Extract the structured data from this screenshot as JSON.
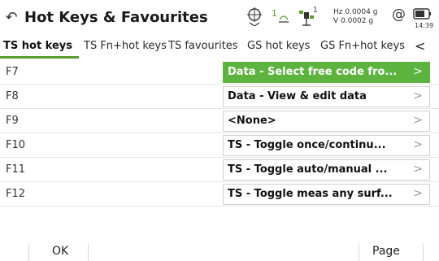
{
  "window": {
    "title": "Hot Keys & Favourites"
  },
  "status_bar": {
    "bluetooth_icon": "target-crosshair-icon",
    "signal_text": "1",
    "satellite_text": "1",
    "hz_label": "Hz 0.0004 g",
    "v_label": "V  0.0002 g",
    "prism_icon": "at-prism-icon",
    "battery_icon": "battery-icon",
    "time": "14:39"
  },
  "tabs": [
    {
      "label": "TS hot keys",
      "active": true
    },
    {
      "label": "TS Fn+hot keys",
      "active": false
    },
    {
      "label": "TS favourites",
      "active": false
    },
    {
      "label": "GS hot keys",
      "active": false
    },
    {
      "label": "GS Fn+hot keys",
      "active": false
    }
  ],
  "tab_nav": {
    "prev": "<",
    "next": ">"
  },
  "rows": [
    {
      "key": "F7",
      "value": "Data - Select free code fro...",
      "selected": true
    },
    {
      "key": "F8",
      "value": "Data - View & edit data",
      "selected": false
    },
    {
      "key": "F9",
      "value": "<None>",
      "selected": false
    },
    {
      "key": "F10",
      "value": "TS - Toggle once/continu...",
      "selected": false
    },
    {
      "key": "F11",
      "value": "TS - Toggle auto/manual ...",
      "selected": false
    },
    {
      "key": "F12",
      "value": "TS - Toggle meas any surf...",
      "selected": false
    }
  ],
  "chevron": ">",
  "softkeys": {
    "ok": "OK",
    "page": "Page"
  },
  "colors": {
    "accent_green": "#5cb33e",
    "tab_underline": "#5a9e2f"
  }
}
